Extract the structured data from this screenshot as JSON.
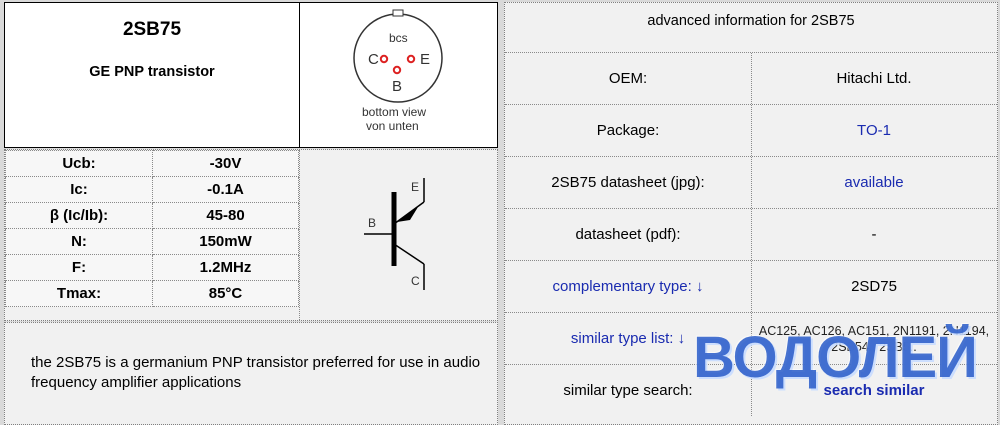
{
  "header": {
    "title": "2SB75",
    "subtitle": "GE PNP transistor"
  },
  "pinout": {
    "label_top": "bcs",
    "pin_c": "C",
    "pin_e": "E",
    "pin_b": "B",
    "caption_1": "bottom view",
    "caption_2": "von unten"
  },
  "parameters": [
    {
      "label": "Ucb:",
      "value": "-30V"
    },
    {
      "label": "Ic:",
      "value": "-0.1A"
    },
    {
      "label": "β (Ic/Ib):",
      "value": "45-80"
    },
    {
      "label": "N:",
      "value": "150mW"
    },
    {
      "label": "F:",
      "value": "1.2MHz"
    },
    {
      "label": "Tmax:",
      "value": "85°C"
    }
  ],
  "symbol": {
    "pin_e": "E",
    "pin_b": "B",
    "pin_c": "C"
  },
  "description": "the 2SB75 is a germanium PNP transistor preferred for use in audio frequency amplifier applications",
  "advanced": {
    "heading": "advanced information for 2SB75",
    "rows": [
      {
        "label": "OEM:",
        "value": "Hitachi Ltd."
      },
      {
        "label": "Package:",
        "value": "TO-1"
      },
      {
        "label": "2SB75 datasheet (jpg):",
        "value": "available"
      },
      {
        "label": "datasheet (pdf):",
        "value": "-"
      },
      {
        "label": "complementary type: ↓",
        "value": "2SD75"
      },
      {
        "label": "similar type list: ↓",
        "value": "AC125, AC126, AC151, 2N1191, 2N1194, 2SB54.. 2SB5.."
      },
      {
        "label": "similar type search:",
        "value": "search similar"
      }
    ]
  },
  "watermark": "ВОДОЛЕЙ",
  "colors": {
    "link": "#1a2bb0",
    "watermark": "#285ac8"
  }
}
